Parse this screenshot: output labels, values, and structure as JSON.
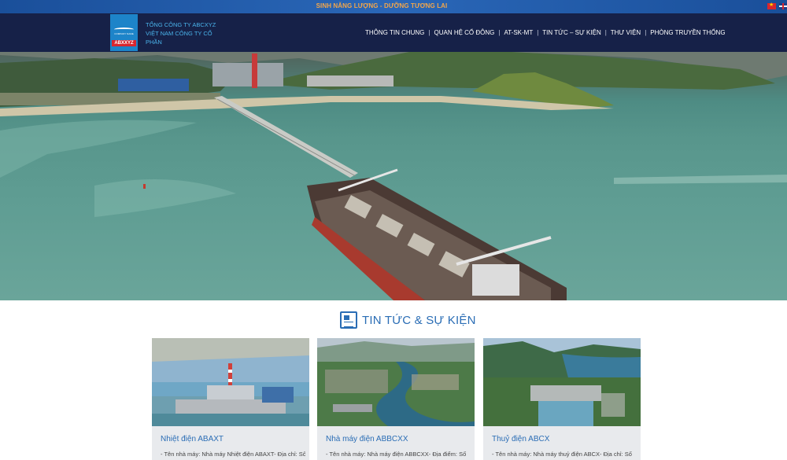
{
  "topbar": {
    "slogan": "SINH NĂNG LƯỢNG - DƯỠNG TƯƠNG LAI"
  },
  "header": {
    "logo": {
      "tagline": "COMPANY NAME",
      "name": "ABXXYZ"
    },
    "company_lines": [
      "TỔNG CÔNG TY ABCXYZ",
      "VIỆT NAM CÔNG TY CỔ",
      "PHẦN"
    ],
    "nav": [
      "THÔNG TIN CHUNG",
      "QUAN HỆ CỔ ĐÔNG",
      "AT-SK-MT",
      "TIN TỨC – SỰ KIỆN",
      "THƯ VIỆN",
      "PHÒNG TRUYỀN THỐNG"
    ],
    "nav_separator": "|",
    "languages": [
      "vietnamese-flag-icon",
      "english-flag-icon"
    ]
  },
  "hero": {
    "image": "power-plant-port-aerial-photo"
  },
  "news": {
    "section_title": "TIN TỨC & SỰ KIỆN",
    "icon": "newspaper-icon",
    "cards": [
      {
        "title": "Nhiệt điện ABAXT",
        "desc": "- Tên nhà máy: Nhà máy Nhiệt điện ABAXT- Địa chỉ: Số",
        "image": "thermal-power-plant-photo"
      },
      {
        "title": "Nhà máy điện ABBCXX",
        "desc": "- Tên nhà máy: Nhà máy điện ABBCXX- Địa điểm: Số",
        "image": "river-valley-power-plant-photo"
      },
      {
        "title": "Thuỷ điện ABCX",
        "desc": "- Tên nhà máy: Nhà máy thuỷ điện ABCX- Địa chỉ: Số",
        "image": "hydro-dam-photo"
      }
    ]
  },
  "colors": {
    "topbar": "#1a4f9a",
    "slogan": "#f3a64a",
    "header": "#162148",
    "logo": "#1d84c9",
    "accent": "#2a6db5",
    "card_bg": "#e8eaed"
  }
}
